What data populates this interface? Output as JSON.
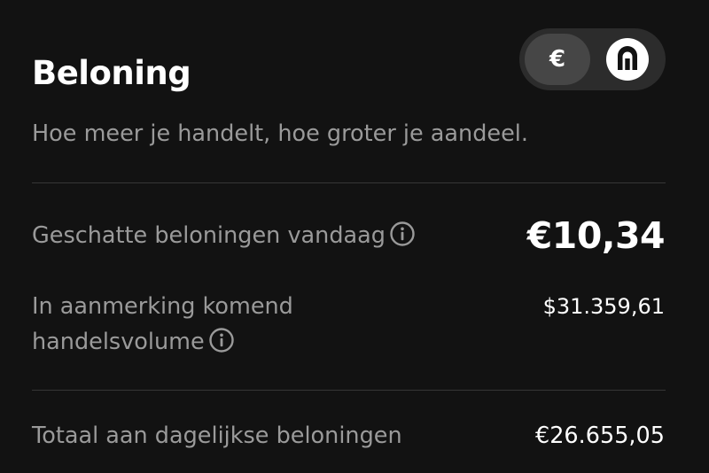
{
  "reward": {
    "title": "Beloning",
    "subtitle": "Hoe meer je handelt, hoe groter je aandeel.",
    "currency_toggle": {
      "options": [
        {
          "icon": "euro-icon",
          "label": "€",
          "selected": false
        },
        {
          "icon": "token-logo-icon",
          "label": "",
          "selected": true
        }
      ]
    },
    "rows": [
      {
        "label": "Geschatte beloningen vandaag",
        "value": "€10,34",
        "has_info": true
      },
      {
        "label_line1": "In aanmerking komend",
        "label_line2": "handelsvolume",
        "value": "$31.359,61",
        "has_info": true
      },
      {
        "label": "Totaal aan dagelijkse beloningen",
        "value": "€26.655,05",
        "has_info": false
      }
    ]
  },
  "colors": {
    "background": "#121212",
    "text_primary": "#ffffff",
    "text_secondary": "#9a9a9a",
    "divider": "#363636",
    "toggle_bg": "#2c2c2c",
    "toggle_selected_bg": "#464646"
  }
}
